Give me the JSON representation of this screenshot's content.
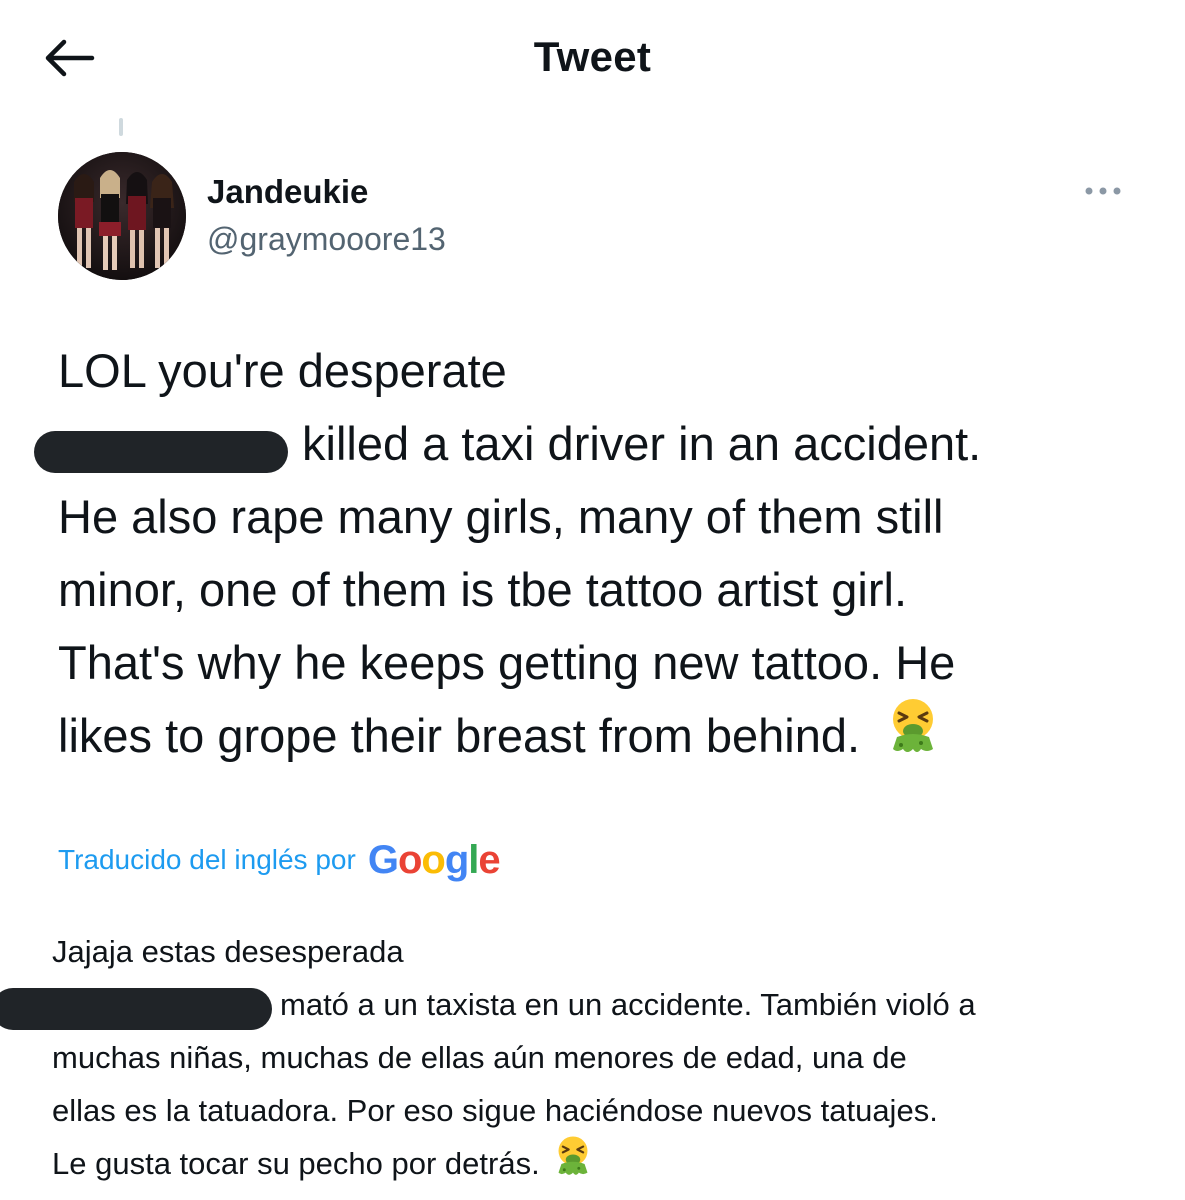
{
  "header": {
    "title": "Tweet",
    "back_icon": "arrow-left-icon"
  },
  "tweet": {
    "author": {
      "display_name": "Jandeukie",
      "handle": "@graymooore13"
    },
    "more_icon": "more-horizontal-icon",
    "text_lines": [
      "LOL you're desperate",
      "killed a taxi driver in an accident.",
      "He also rape many girls, many of them still",
      "minor, one of them is tbe tattoo artist girl.",
      "That's why he keeps getting new tattoo. He",
      "likes to grope their breast from behind."
    ],
    "emoji": "nauseated-face-emoji",
    "translation_label": "Traducido del inglés por",
    "translation_provider": "Google",
    "translation_lines": [
      "Jajaja estas desesperada",
      "mató a un taxista en un accidente. También violó a",
      "muchas niñas, muchas de ellas aún menores de edad, una de",
      "ellas es la tatuadora. Por eso sigue haciéndose nuevos tatuajes.",
      "Le gusta tocar su pecho por detrás."
    ]
  },
  "colors": {
    "accent": "#1d9bf0",
    "text_primary": "#0f1419",
    "text_secondary": "#536471",
    "google_blue": "#4285f4",
    "google_red": "#ea4335",
    "google_yellow": "#fbbc05",
    "google_green": "#34a853"
  }
}
